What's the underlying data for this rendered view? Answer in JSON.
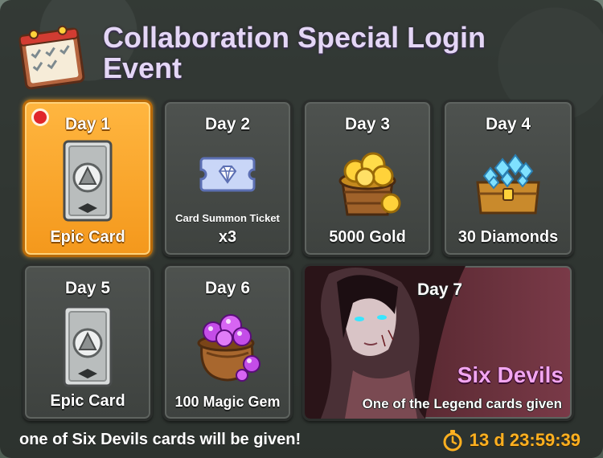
{
  "event": {
    "title_line1": "Collaboration Special Login",
    "title_line2": "Event"
  },
  "days": [
    {
      "day": "Day 1",
      "reward": "Epic Card",
      "icon": "epic-card-icon",
      "claimable": true
    },
    {
      "day": "Day 2",
      "reward_sub": "Card Summon Ticket",
      "reward": "x3",
      "icon": "summon-ticket-icon",
      "claimable": false
    },
    {
      "day": "Day 3",
      "reward": "5000 Gold",
      "icon": "gold-bucket-icon",
      "claimable": false
    },
    {
      "day": "Day 4",
      "reward": "30 Diamonds",
      "icon": "diamond-chest-icon",
      "claimable": false
    },
    {
      "day": "Day 5",
      "reward": "Epic Card",
      "icon": "epic-card-icon",
      "claimable": false
    },
    {
      "day": "Day 6",
      "reward": "100 Magic Gem",
      "icon": "magic-gem-bag-icon",
      "claimable": false
    },
    {
      "day": "Day 7",
      "reward_title": "Six Devils",
      "reward": "One of the Legend cards given",
      "icon": "six-devils-portrait",
      "claimable": false
    }
  ],
  "footer": {
    "note": "one of Six Devils cards will be given!",
    "timer": "13 d 23:59:39",
    "timer_icon": "stopwatch-icon"
  },
  "colors": {
    "title": "#e4d6f6",
    "active_card": "#f4981c",
    "timer": "#ffb020",
    "six_devils": "#f2a6f0"
  }
}
